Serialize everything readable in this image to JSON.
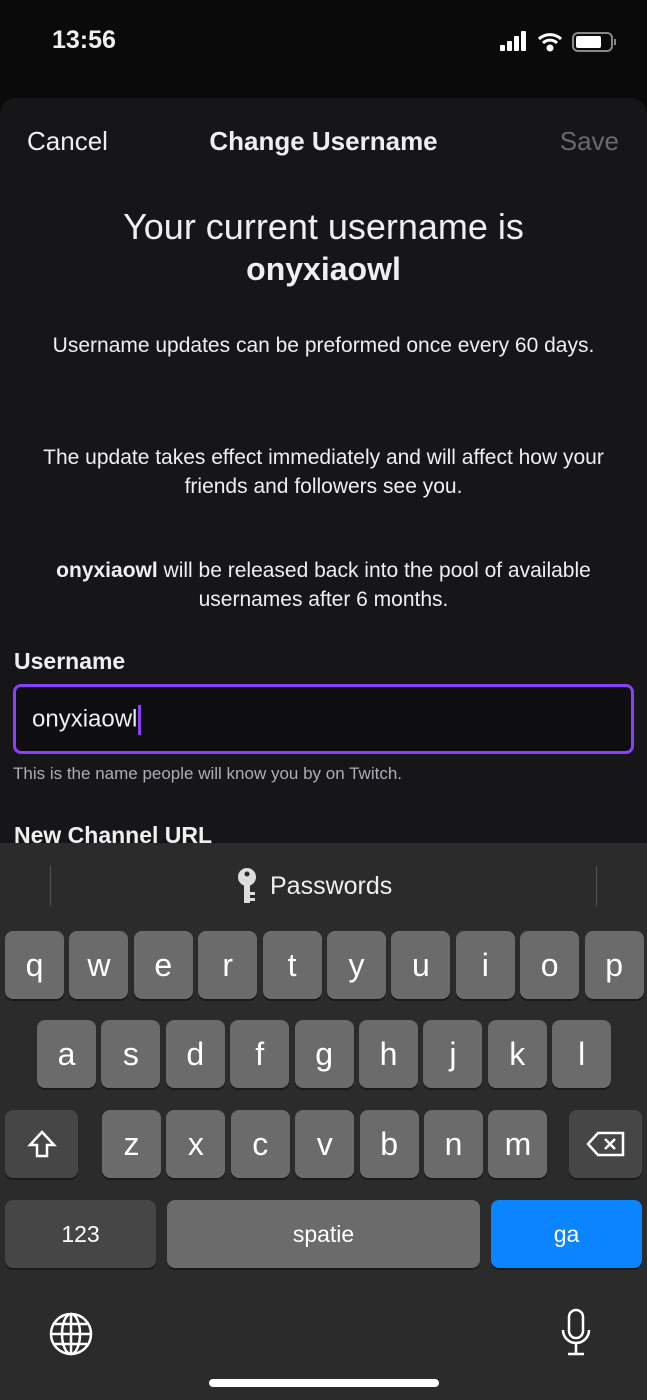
{
  "status_bar": {
    "time": "13:56",
    "icons": [
      "signal-icon",
      "wifi-icon",
      "battery-icon"
    ]
  },
  "nav": {
    "cancel": "Cancel",
    "title": "Change Username",
    "save": "Save"
  },
  "content": {
    "heading_line1": "Your current username is",
    "heading_username": "onyxiaowl",
    "info1": "Username updates can be preformed once every 60 days.",
    "info2": "The update takes effect immediately and will affect how your friends and followers see you.",
    "info3_username": "onyxiaowl",
    "info3_rest": " will be released back into the pool of available usernames after 6 months."
  },
  "form": {
    "username_label": "Username",
    "username_value": "onyxiaowl",
    "username_hint": "This is the name people will know you by on Twitch.",
    "channel_url_label": "New Channel URL"
  },
  "keyboard": {
    "passwords": "Passwords",
    "row1": [
      "q",
      "w",
      "e",
      "r",
      "t",
      "y",
      "u",
      "i",
      "o",
      "p"
    ],
    "row2": [
      "a",
      "s",
      "d",
      "f",
      "g",
      "h",
      "j",
      "k",
      "l"
    ],
    "row3": [
      "z",
      "x",
      "c",
      "v",
      "b",
      "n",
      "m"
    ],
    "numbers": "123",
    "space": "spatie",
    "go": "ga"
  },
  "colors": {
    "accent": "#8a3ffc",
    "go_key": "#0a84ff"
  }
}
